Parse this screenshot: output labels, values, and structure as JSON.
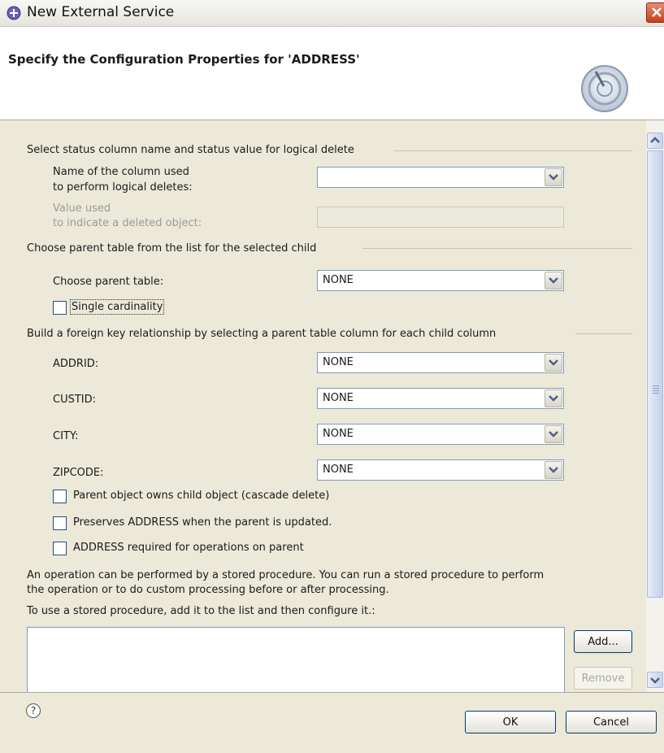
{
  "window": {
    "title": "New External Service"
  },
  "banner": {
    "heading": "Specify the Configuration Properties for 'ADDRESS'"
  },
  "logical_delete": {
    "section_title": "Select status column name and status value for logical delete",
    "column_label_line1": "Name of the column used",
    "column_label_line2": "to perform logical deletes:",
    "column_value": "",
    "value_label_line1": "Value used",
    "value_label_line2": "to indicate a deleted object:",
    "value_value": ""
  },
  "parent_table": {
    "section_title": "Choose parent table from the list for the selected child",
    "label": "Choose parent table:",
    "value": "NONE",
    "single_cardinality_label": "Single cardinality",
    "single_cardinality_checked": false
  },
  "foreign_key": {
    "section_title": "Build a foreign key relationship by selecting a parent table column for each child column",
    "rows": [
      {
        "label": "ADDRID:",
        "value": "NONE"
      },
      {
        "label": "CUSTID:",
        "value": "NONE"
      },
      {
        "label": "CITY:",
        "value": "NONE"
      },
      {
        "label": "ZIPCODE:",
        "value": "NONE"
      }
    ],
    "options": [
      {
        "label": "Parent object owns child object (cascade delete)",
        "checked": false
      },
      {
        "label": "Preserves ADDRESS when the parent is updated.",
        "checked": false
      },
      {
        "label": "ADDRESS required for operations on parent",
        "checked": false
      }
    ]
  },
  "stored_procedure": {
    "desc_line1": "An operation can be performed by a stored procedure. You can run a stored procedure to perform",
    "desc_line2": "the operation or to do custom processing before or after processing.",
    "instruction": "To use a stored procedure, add it to the list and then configure it.:",
    "add_label": "Add...",
    "remove_label": "Remove"
  },
  "footer": {
    "ok_label": "OK",
    "cancel_label": "Cancel",
    "help_symbol": "?"
  }
}
